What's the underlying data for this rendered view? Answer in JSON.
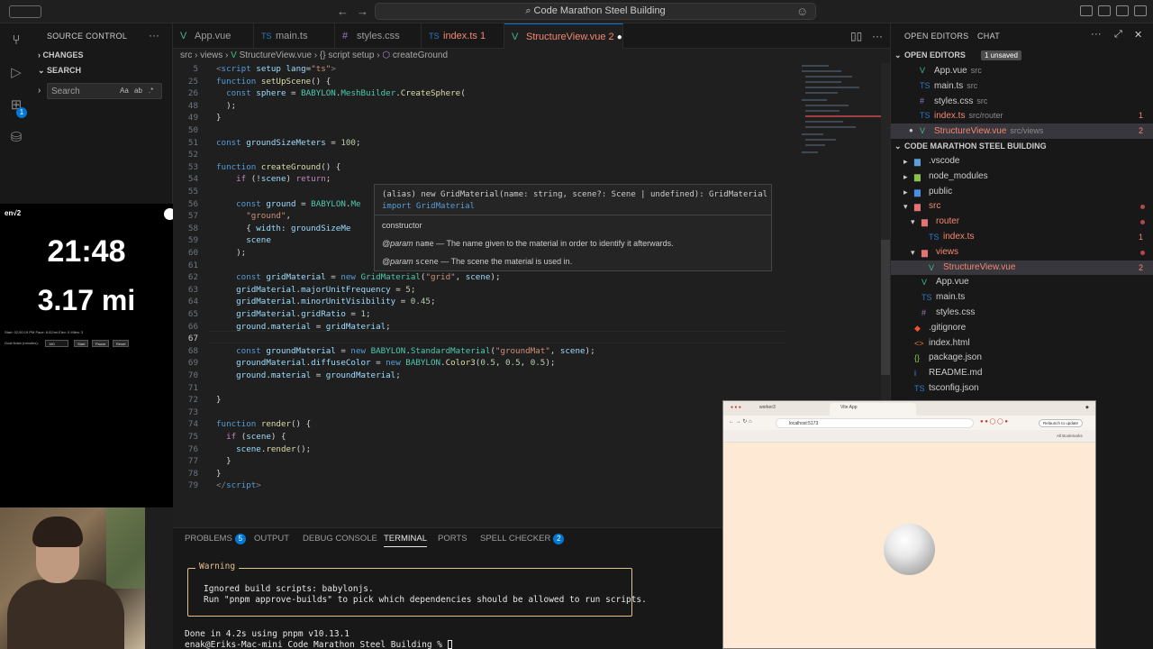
{
  "titlebar": {
    "search_text": "Code Marathon Steel Building"
  },
  "source_control": {
    "title": "SOURCE CONTROL",
    "changes": "CHANGES",
    "search_section": "SEARCH",
    "search_placeholder": "Search",
    "opt_case": "Aa",
    "opt_word": "ab",
    "opt_regex": ".*",
    "badge": "1"
  },
  "overlay": {
    "label": "en√2",
    "timer": "21:48",
    "distance": "3.17 mi",
    "small_line1": "Start: 02:50:19 PM   Pace: 6:52/mi   Elev: 0   Miles: 3",
    "goal_label": "Goal finish (minutes):",
    "goal_value": "180",
    "start_btn": "Start",
    "pause_btn": "Pause",
    "reset_btn": "Reset"
  },
  "tabs": [
    {
      "label": "App.vue",
      "icon": "V",
      "color": "#41b883"
    },
    {
      "label": "main.ts",
      "icon": "TS",
      "color": "#3178c6"
    },
    {
      "label": "styles.css",
      "icon": "#",
      "color": "#a074c4"
    },
    {
      "label": "index.ts",
      "icon": "TS",
      "color": "#3178c6",
      "errors": "1"
    },
    {
      "label": "StructureView.vue",
      "icon": "V",
      "color": "#41b883",
      "errors": "2"
    }
  ],
  "breadcrumb": {
    "src": "src",
    "views": "views",
    "file": "StructureView.vue",
    "setup": "{} script setup",
    "fn": "createGround"
  },
  "code": {
    "l5": "5",
    "l25": "25",
    "l26": "26",
    "l48": "48",
    "l49": "49",
    "l50": "50",
    "l51": "51",
    "l52": "52",
    "l53": "53",
    "l54": "54",
    "l55": "55",
    "l56": "56",
    "l57": "57",
    "l58": "58",
    "l59": "59",
    "l60": "60",
    "l61": "61",
    "l62": "62",
    "l63": "63",
    "l64": "64",
    "l65": "65",
    "l66": "66",
    "l67": "67",
    "l68": "68",
    "l69": "69",
    "l70": "70",
    "l71": "71",
    "l72": "72",
    "l73": "73",
    "l74": "74",
    "l75": "75",
    "l76": "76",
    "l77": "77",
    "l78": "78",
    "l79": "79"
  },
  "hover": {
    "sig_alias": "(alias) new GridMaterial(name: string, scene?: Scene | undefined): GridMaterial",
    "sig_import": "import GridMaterial",
    "kind": "constructor",
    "param1_tag": "@param",
    "param1_name": "name",
    "param1_desc": "— The name given to the material in order to identify it afterwards.",
    "param2_tag": "@param",
    "param2_name": "scene",
    "param2_desc": "— The scene the material is used in."
  },
  "panel": {
    "problems": "PROBLEMS",
    "problems_count": "5",
    "output": "OUTPUT",
    "debug": "DEBUG CONSOLE",
    "terminal": "TERMINAL",
    "ports": "PORTS",
    "spell": "SPELL CHECKER",
    "spell_count": "2",
    "warning_label": "Warning",
    "warning_line1": "Ignored build scripts: babylonjs.",
    "warning_line2": "Run \"pnpm approve-builds\" to pick which dependencies should be allowed to run scripts.",
    "done": "Done in 4.2s using pnpm v10.13.1",
    "prompt": "enak@Eriks-Mac-mini Code Marathon Steel Building % "
  },
  "explorer": {
    "tab_open": "OPEN EDITORS",
    "tab_chat": "CHAT",
    "open_editors": "OPEN EDITORS",
    "unsaved": "1 unsaved",
    "project": "CODE MARATHON STEEL BUILDING",
    "open": [
      {
        "name": "App.vue",
        "path": "src",
        "icon": "V",
        "color": "#41b883"
      },
      {
        "name": "main.ts",
        "path": "src",
        "icon": "TS",
        "color": "#3178c6"
      },
      {
        "name": "styles.css",
        "path": "src",
        "icon": "#",
        "color": "#a074c4"
      },
      {
        "name": "index.ts",
        "path": "src/router",
        "icon": "TS",
        "color": "#3178c6",
        "count": "1"
      },
      {
        "name": "StructureView.vue",
        "path": "src/views",
        "icon": "V",
        "color": "#41b883",
        "count": "2"
      }
    ],
    "tree": [
      {
        "name": ".vscode",
        "depth": 1,
        "icon": "▸",
        "color": "#5f9fd8"
      },
      {
        "name": "node_modules",
        "depth": 1,
        "icon": "▸",
        "color": "#8bc34a"
      },
      {
        "name": "public",
        "depth": 1,
        "icon": "▸",
        "color": "#4a90e2"
      },
      {
        "name": "src",
        "depth": 1,
        "icon": "▾",
        "color": "#e57373"
      },
      {
        "name": "router",
        "depth": 2,
        "icon": "▾",
        "color": "#e57373"
      },
      {
        "name": "index.ts",
        "depth": 3,
        "icon": "TS",
        "color": "#3178c6",
        "count": "1"
      },
      {
        "name": "views",
        "depth": 2,
        "icon": "▾",
        "color": "#e57373"
      },
      {
        "name": "StructureView.vue",
        "depth": 3,
        "icon": "V",
        "color": "#41b883",
        "count": "2"
      },
      {
        "name": "App.vue",
        "depth": 2,
        "icon": "V",
        "color": "#41b883"
      },
      {
        "name": "main.ts",
        "depth": 2,
        "icon": "TS",
        "color": "#3178c6"
      },
      {
        "name": "styles.css",
        "depth": 2,
        "icon": "#",
        "color": "#a074c4"
      },
      {
        "name": ".gitignore",
        "depth": 1,
        "icon": "◆",
        "color": "#f05133"
      },
      {
        "name": "index.html",
        "depth": 1,
        "icon": "<>",
        "color": "#e37933"
      },
      {
        "name": "package.json",
        "depth": 1,
        "icon": "{}",
        "color": "#8bc34a"
      },
      {
        "name": "README.md",
        "depth": 1,
        "icon": "i",
        "color": "#4a90e2"
      },
      {
        "name": "tsconfig.json",
        "depth": 1,
        "icon": "TS",
        "color": "#3178c6"
      }
    ]
  },
  "browser": {
    "tab1": "worker3",
    "tab2": "Vite App",
    "url": "localhost:5173",
    "relaunch": "Relaunch to update",
    "bookmarks": "All Bookmarks"
  }
}
